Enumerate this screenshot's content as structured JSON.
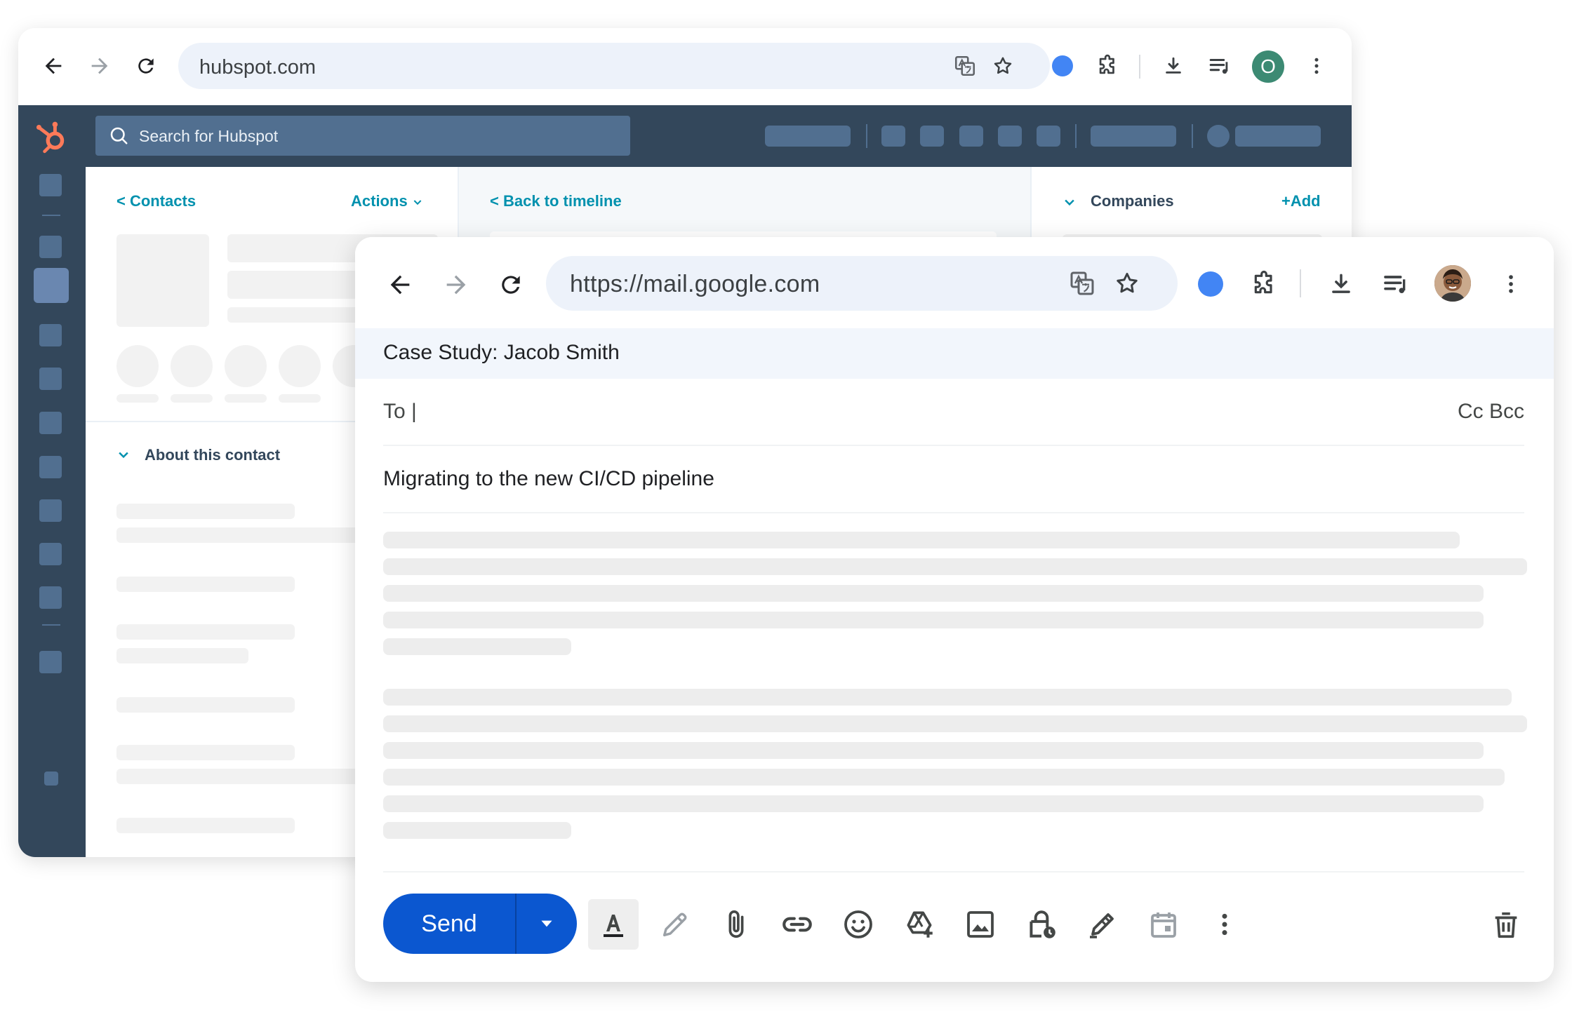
{
  "colors": {
    "hubspot_nav": "#33475b",
    "hubspot_accent": "#ff7a59",
    "hubspot_link": "#0091ae",
    "gmail_send": "#0b57d0",
    "profile_dot": "#4285f4",
    "hs_avatar": "#3c8a73"
  },
  "hubspot_browser": {
    "url": "hubspot.com",
    "avatar_letter": "O",
    "icons": [
      "back-arrow-icon",
      "forward-arrow-icon",
      "reload-icon",
      "translate-icon",
      "star-icon",
      "profile-dot-icon",
      "extensions-icon",
      "download-icon",
      "media-queue-icon",
      "kebab-menu-icon"
    ]
  },
  "hubspot_app": {
    "search_placeholder": "Search for Hubspot",
    "left_col": {
      "back_link": "< Contacts",
      "actions": "Actions",
      "about_heading": "About this contact"
    },
    "mid_col": {
      "back_link": "< Back to timeline"
    },
    "right_col": {
      "heading": "Companies",
      "add_link": "+Add"
    }
  },
  "gmail_browser": {
    "url": "https://mail.google.com",
    "icons": [
      "back-arrow-icon",
      "forward-arrow-icon",
      "reload-icon",
      "translate-icon",
      "star-icon",
      "profile-dot-icon",
      "extensions-icon",
      "download-icon",
      "media-queue-icon",
      "avatar",
      "kebab-menu-icon"
    ]
  },
  "compose": {
    "window_title": "Case Study: Jacob Smith",
    "to_label": "To |",
    "cc_bcc": "Cc Bcc",
    "subject": "Migrating to the new CI/CD pipeline",
    "send_label": "Send",
    "toolbar_icons": [
      "text-format-icon",
      "pen-icon",
      "attach-icon",
      "link-icon",
      "emoji-icon",
      "drive-icon",
      "image-icon",
      "confidential-icon",
      "signature-icon",
      "schedule-icon",
      "more-options-icon",
      "delete-icon"
    ]
  }
}
